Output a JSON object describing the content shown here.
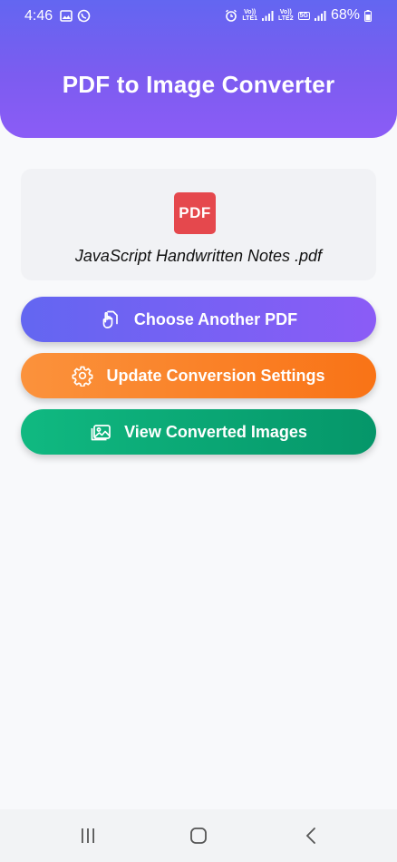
{
  "status_bar": {
    "time": "4:46",
    "sim1_label": "LTE1",
    "sim2_label": "LTE2",
    "network_5g": "5G",
    "battery": "68%"
  },
  "header": {
    "title": "PDF to Image Converter"
  },
  "file_card": {
    "badge": "PDF",
    "file_name": "JavaScript Handwritten Notes .pdf"
  },
  "actions": {
    "choose_label": "Choose Another PDF",
    "settings_label": "Update Conversion Settings",
    "view_label": "View Converted Images"
  },
  "colors": {
    "header_start": "#6366f1",
    "header_end": "#8b5cf6",
    "pdf_badge": "#e5484d",
    "settings_start": "#fb923c",
    "settings_end": "#f97316",
    "view_start": "#10b981",
    "view_end": "#059669"
  },
  "icons": {
    "choose": "hand-pointer-file-icon",
    "settings": "gear-icon",
    "view": "image-gallery-icon"
  }
}
